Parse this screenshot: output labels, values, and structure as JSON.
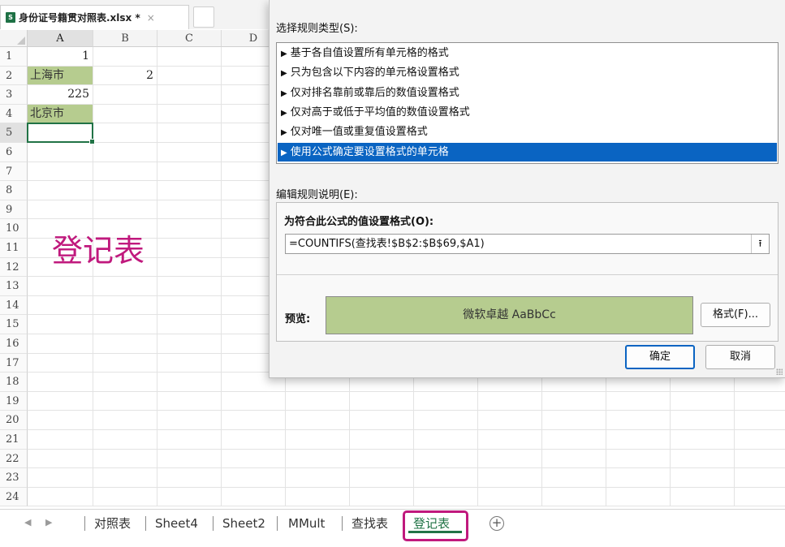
{
  "file_tab": {
    "name": "身份证号籍贯对照表.xlsx *",
    "close": "×",
    "icon": "excel-file-icon"
  },
  "grid": {
    "columns": [
      "A",
      "B",
      "C",
      "D"
    ],
    "rows": [
      "1",
      "2",
      "3",
      "4",
      "5",
      "6",
      "7",
      "8",
      "9",
      "10",
      "11",
      "12",
      "13",
      "14",
      "15",
      "16",
      "17",
      "18",
      "19",
      "20",
      "21",
      "22",
      "23",
      "24"
    ],
    "cells": {
      "A1": "1",
      "A2": "上海市",
      "B2": "2",
      "A3": "225",
      "A4": "北京市"
    },
    "active_cell": "A5",
    "highlight_color": "#b6cc8f",
    "annotation": "登记表",
    "annotation_color": "#c0197d"
  },
  "sheet_tabs": {
    "nav_prev": "◀",
    "nav_next": "▶",
    "tabs": [
      "对照表",
      "Sheet4",
      "Sheet2",
      "MMult",
      "查找表",
      "登记表"
    ],
    "active": "登记表",
    "add": "+",
    "accent": "#217346"
  },
  "dialog": {
    "select_rule_type_label": "选择规则类型(S):",
    "rules": [
      "基于各自值设置所有单元格的格式",
      "只为包含以下内容的单元格设置格式",
      "仅对排名靠前或靠后的数值设置格式",
      "仅对高于或低于平均值的数值设置格式",
      "仅对唯一值或重复值设置格式",
      "使用公式确定要设置格式的单元格"
    ],
    "selected_rule_index": 5,
    "edit_rule_label": "编辑规则说明(E):",
    "formula_label": "为符合此公式的值设置格式(O):",
    "formula_value": "=COUNTIFS(查找表!$B$2:$B$69,$A1)",
    "collapse_icon": "⭱",
    "preview_label": "预览:",
    "preview_text": "微软卓越  AaBbCc",
    "format_button": "格式(F)...",
    "ok_button": "确定",
    "cancel_button": "取消",
    "selection_color": "#0a64c2"
  }
}
